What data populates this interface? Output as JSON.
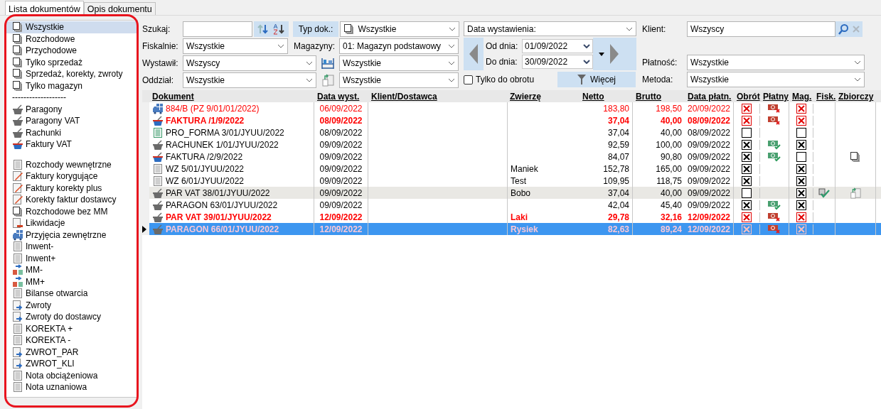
{
  "tabs": [
    {
      "label": "Lista dokumentów",
      "selected": true
    },
    {
      "label": "Opis dokumentu",
      "selected": false
    }
  ],
  "sidebar": {
    "items": [
      {
        "label": "Wszystkie",
        "kind": "docs",
        "selected": true
      },
      {
        "label": "Rozchodowe",
        "kind": "docs",
        "selected": false
      },
      {
        "label": "Przychodowe",
        "kind": "docs",
        "selected": false
      },
      {
        "label": "Tylko sprzedaż",
        "kind": "docs",
        "selected": false
      },
      {
        "label": "Sprzedaż, korekty, zwroty",
        "kind": "docs",
        "selected": false
      },
      {
        "label": "Tylko magazyn",
        "kind": "docs",
        "selected": false
      },
      {
        "label": "-------------------",
        "kind": "separator",
        "selected": false
      },
      {
        "label": "Paragony",
        "kind": "basket_gray",
        "selected": false
      },
      {
        "label": "Paragony VAT",
        "kind": "basket_gray",
        "selected": false
      },
      {
        "label": "Rachunki",
        "kind": "basket_gray",
        "selected": false
      },
      {
        "label": "Faktury VAT",
        "kind": "basket_blue",
        "selected": false
      },
      {
        "label": "Rozchody wewnętrzne",
        "kind": "page",
        "selected": false,
        "gap_before": true
      },
      {
        "label": "Faktury korygujące",
        "kind": "pencil",
        "selected": false
      },
      {
        "label": "Faktury korekty plus",
        "kind": "pencil",
        "selected": false
      },
      {
        "label": "Korekty faktur dostawcy",
        "kind": "pencil",
        "selected": false
      },
      {
        "label": "Rozchodowe bez MM",
        "kind": "docs",
        "selected": false
      },
      {
        "label": "Likwidacje",
        "kind": "minus",
        "selected": false
      },
      {
        "label": "Przyjęcia zewnętrzne",
        "kind": "truck",
        "selected": false
      },
      {
        "label": "Inwent-",
        "kind": "page",
        "selected": false
      },
      {
        "label": "Inwent+",
        "kind": "page",
        "selected": false
      },
      {
        "label": "MM-",
        "kind": "transfer",
        "selected": false
      },
      {
        "label": "MM+",
        "kind": "transfer",
        "selected": false
      },
      {
        "label": "Bilanse otwarcia",
        "kind": "page",
        "selected": false
      },
      {
        "label": "Zwroty",
        "kind": "return",
        "selected": false
      },
      {
        "label": "Zwroty do dostawcy",
        "kind": "return",
        "selected": false
      },
      {
        "label": "KOREKTA +",
        "kind": "page",
        "selected": false
      },
      {
        "label": "KOREKTA -",
        "kind": "page",
        "selected": false
      },
      {
        "label": "ZWROT_PAR",
        "kind": "return",
        "selected": false
      },
      {
        "label": "ZWROT_KLI",
        "kind": "return",
        "selected": false
      },
      {
        "label": "Nota obciążeniowa",
        "kind": "page",
        "selected": false
      },
      {
        "label": "Nota uznaniowa",
        "kind": "page",
        "selected": false
      }
    ]
  },
  "filters": {
    "search": {
      "label": "Szukaj:"
    },
    "doc_type": {
      "label": "Typ dok.:",
      "value": "Wszystkie"
    },
    "fiscal": {
      "label": "Fiskalnie:",
      "value": "Wszystkie"
    },
    "warehouses": {
      "label": "Magazyny:",
      "value": "01: Magazyn podstawowy"
    },
    "issuer": {
      "label": "Wystawił:",
      "value": "Wszyscy"
    },
    "shelf": {
      "value": "Wszystkie"
    },
    "branch": {
      "label": "Oddział:",
      "value": "Wszystkie"
    },
    "category": {
      "value": "Wszystkie"
    },
    "date_kind": {
      "value": "Data wystawienia:"
    },
    "from": {
      "label": "Od dnia:",
      "value": "01/09/2022"
    },
    "to": {
      "label": "Do dnia:",
      "value": "30/09/2022"
    },
    "turnover_only": {
      "label": "Tylko do obrotu",
      "checked": false
    },
    "more": {
      "label": "Więcej"
    },
    "client": {
      "label": "Klient:",
      "value": "Wszyscy"
    },
    "payment": {
      "label": "Płatność:",
      "value": "Wszystkie"
    },
    "method": {
      "label": "Metoda:",
      "value": "Wszystkie"
    }
  },
  "table": {
    "columns": [
      "Dokument",
      "Data wyst.",
      "Klient/Dostawca",
      "Zwierzę",
      "Netto",
      "Brutto",
      "Data płatn.",
      "Obrót",
      "Płatny",
      "Mag.",
      "Fisk.",
      "Zbiorczy"
    ],
    "rows": [
      {
        "kind": "truck",
        "overdue": true,
        "bold": false,
        "selected": false,
        "marked": false,
        "document": "884/B (PZ 9/01/01/2022)",
        "date": "06/09/2022",
        "net": "183,80",
        "gross": "198,50",
        "pay_date": "20/09/2022",
        "turnover": true,
        "paid": false,
        "warehouse": true
      },
      {
        "kind": "basket_blue",
        "overdue": true,
        "bold": true,
        "selected": false,
        "marked": false,
        "document": "FAKTURA /1/9/2022",
        "date": "08/09/2022",
        "net": "37,04",
        "gross": "40,00",
        "pay_date": "08/09/2022",
        "turnover": true,
        "paid": false,
        "warehouse": true
      },
      {
        "kind": "form",
        "overdue": false,
        "bold": false,
        "selected": false,
        "marked": false,
        "document": "PRO_FORMA 3/01/JYUU/2022",
        "date": "08/09/2022",
        "net": "37,04",
        "gross": "40,00",
        "pay_date": "08/09/2022",
        "turnover": false,
        "warehouse": false
      },
      {
        "kind": "basket_gray",
        "overdue": false,
        "bold": false,
        "selected": false,
        "marked": false,
        "document": "RACHUNEK 1/01/JYUU/2022",
        "date": "09/09/2022",
        "net": "92,59",
        "gross": "100,00",
        "pay_date": "09/09/2022",
        "turnover": true,
        "paid": true,
        "warehouse": true
      },
      {
        "kind": "basket_blue",
        "overdue": false,
        "bold": false,
        "selected": false,
        "marked": false,
        "document": "FAKTURA /2/9/2022",
        "date": "09/09/2022",
        "net": "84,07",
        "gross": "90,80",
        "pay_date": "09/09/2022",
        "turnover": true,
        "paid": true,
        "warehouse": false,
        "collective": {
          "kind": "copies"
        }
      },
      {
        "kind": "page",
        "overdue": false,
        "bold": false,
        "selected": false,
        "marked": false,
        "document": "WZ 5/01/JYUU/2022",
        "date": "09/09/2022",
        "animal": "Maniek",
        "net": "152,78",
        "gross": "165,00",
        "pay_date": "09/09/2022",
        "turnover": true,
        "warehouse": true
      },
      {
        "kind": "page",
        "overdue": false,
        "bold": false,
        "selected": false,
        "marked": false,
        "document": "WZ 6/01/JYUU/2022",
        "date": "09/09/2022",
        "animal": "Test",
        "net": "109,95",
        "gross": "118,75",
        "pay_date": "09/09/2022",
        "turnover": true,
        "warehouse": true
      },
      {
        "kind": "basket_gray",
        "overdue": false,
        "bold": false,
        "selected": false,
        "marked": true,
        "document": " PAR VAT 38/01/JYUU/2022",
        "date": "09/09/2022",
        "animal": "Bobo",
        "net": "37,04",
        "gross": "40,00",
        "pay_date": "09/09/2022",
        "turnover": false,
        "warehouse": true,
        "fiscal": true,
        "collective": {
          "kind": "linked"
        }
      },
      {
        "kind": "basket_gray",
        "overdue": false,
        "bold": false,
        "selected": false,
        "marked": false,
        "document": "PARAGON 63/01/JYUU/2022",
        "date": "09/09/2022",
        "net": "42,04",
        "gross": "45,40",
        "pay_date": "09/09/2022",
        "turnover": true,
        "paid": true,
        "warehouse": true
      },
      {
        "kind": "basket_gray",
        "overdue": true,
        "bold": true,
        "selected": false,
        "marked": false,
        "document": "PAR VAT 39/01/JYUU/2022",
        "date": "12/09/2022",
        "animal": "Laki",
        "net": "29,78",
        "gross": "32,16",
        "pay_date": "12/09/2022",
        "turnover": true,
        "paid": false,
        "warehouse": true
      },
      {
        "kind": "basket_gray",
        "overdue": true,
        "bold": true,
        "selected": true,
        "marked": false,
        "document": "PARAGON 66/01/JYUU/2022",
        "date": "12/09/2022",
        "animal": "Rysiek",
        "net": "82,63",
        "gross": "89,24",
        "pay_date": "12/09/2022",
        "turnover": true,
        "paid": false,
        "warehouse": true
      }
    ]
  }
}
